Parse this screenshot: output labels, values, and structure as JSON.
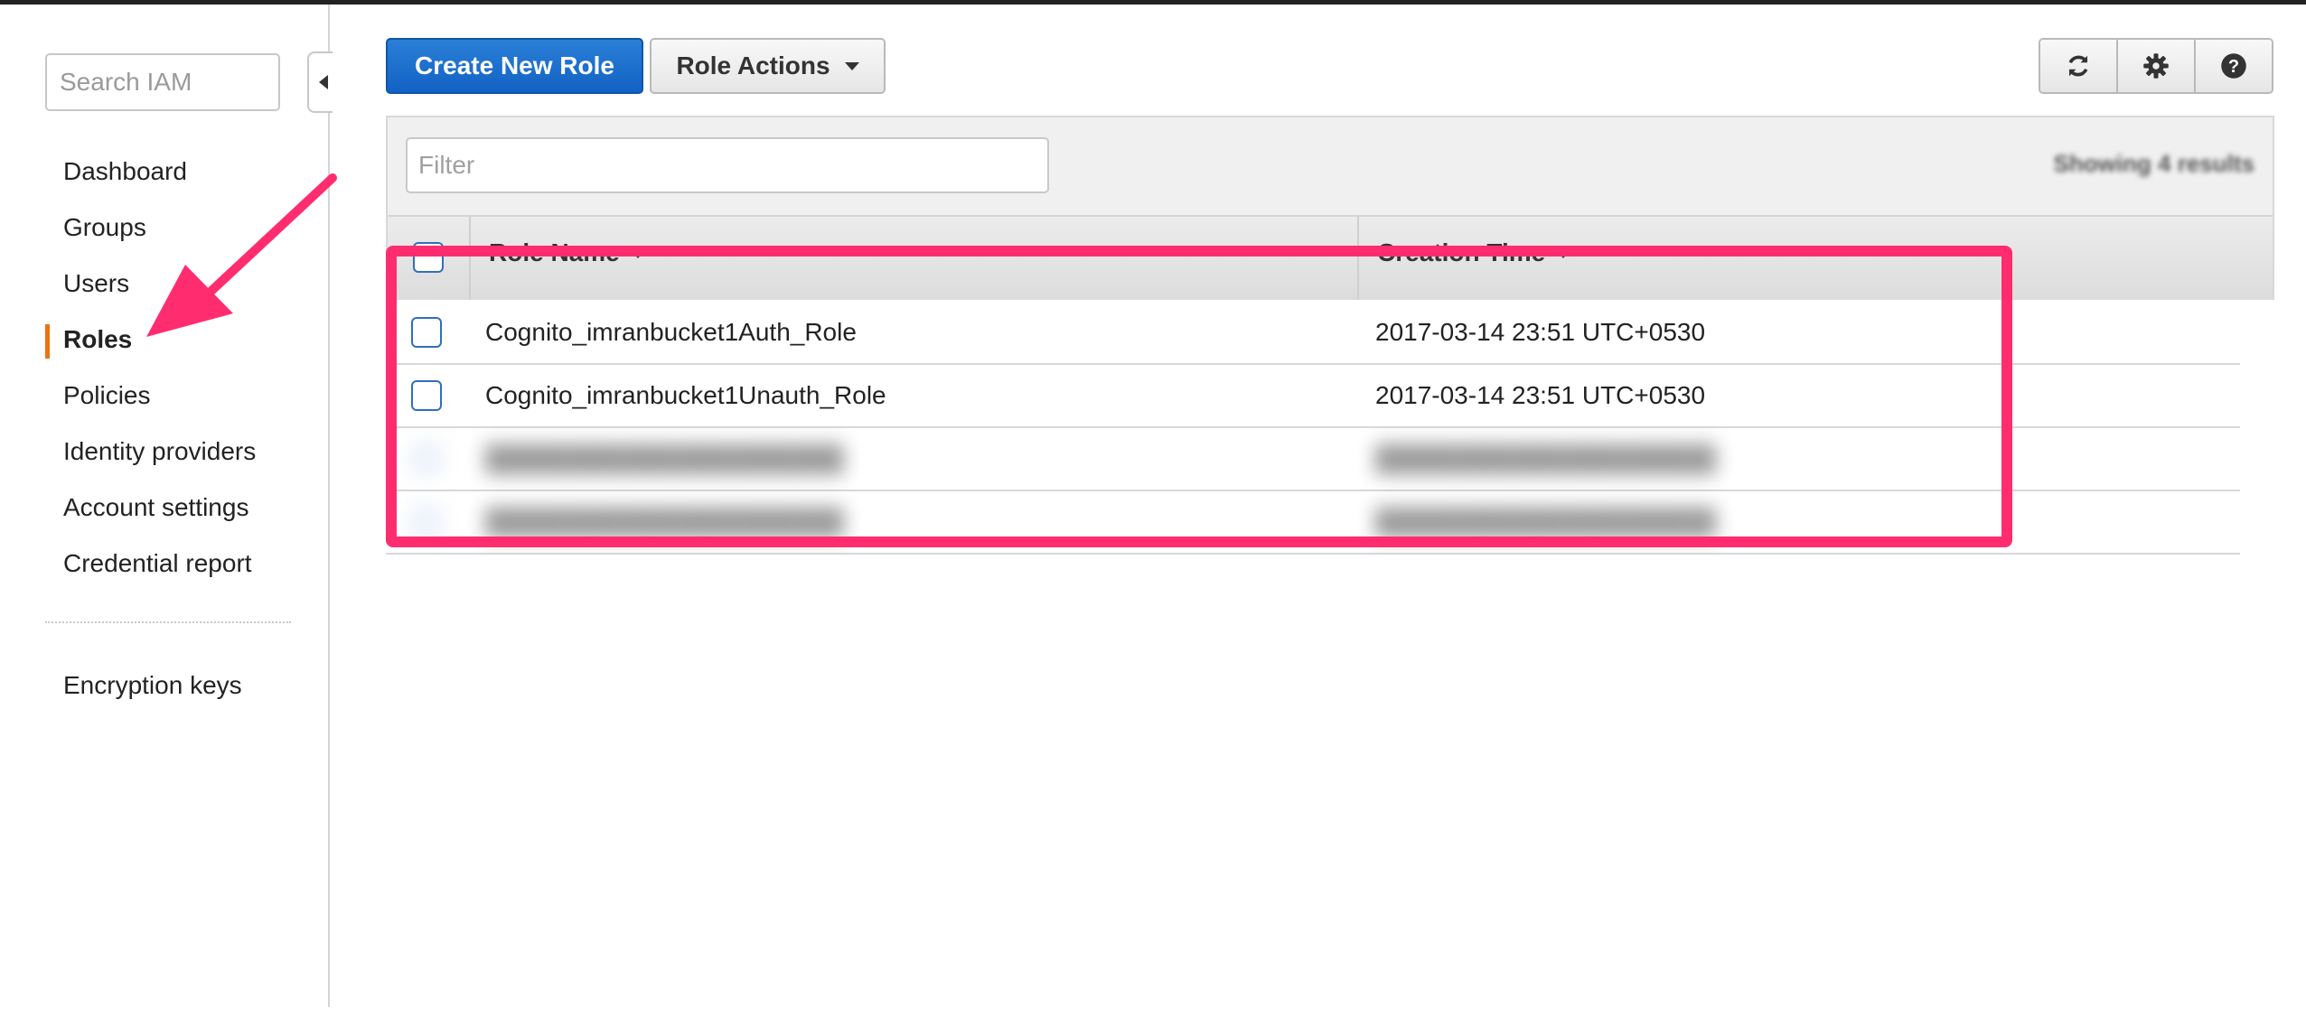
{
  "sidebar": {
    "search_placeholder": "Search IAM",
    "items": [
      {
        "label": "Dashboard",
        "active": false
      },
      {
        "label": "Groups",
        "active": false
      },
      {
        "label": "Users",
        "active": false
      },
      {
        "label": "Roles",
        "active": true
      },
      {
        "label": "Policies",
        "active": false
      },
      {
        "label": "Identity providers",
        "active": false
      },
      {
        "label": "Account settings",
        "active": false
      },
      {
        "label": "Credential report",
        "active": false
      }
    ],
    "secondary_items": [
      {
        "label": "Encryption keys"
      }
    ],
    "active_indicator_color": "#ec7211"
  },
  "toolbar": {
    "create_label": "Create New Role",
    "actions_label": "Role Actions",
    "icons": [
      "refresh-icon",
      "gear-icon",
      "help-icon"
    ],
    "primary_color": "#1a6fcf"
  },
  "table": {
    "filter_placeholder": "Filter",
    "results_text": "Showing 4 results",
    "columns": [
      "Role Name",
      "Creation Time"
    ],
    "rows": [
      {
        "role_name": "Cognito_imranbucket1Auth_Role",
        "creation_time": "2017-03-14 23:51 UTC+0530",
        "blurred": false
      },
      {
        "role_name": "Cognito_imranbucket1Unauth_Role",
        "creation_time": "2017-03-14 23:51 UTC+0530",
        "blurred": false
      },
      {
        "role_name": "████████████████████",
        "creation_time": "███████████████████",
        "blurred": true
      },
      {
        "role_name": "████████████████████",
        "creation_time": "███████████████████",
        "blurred": true
      }
    ]
  },
  "annotations": {
    "highlight_color": "#ff2d6f",
    "arrow_color": "#ff2d6f"
  }
}
